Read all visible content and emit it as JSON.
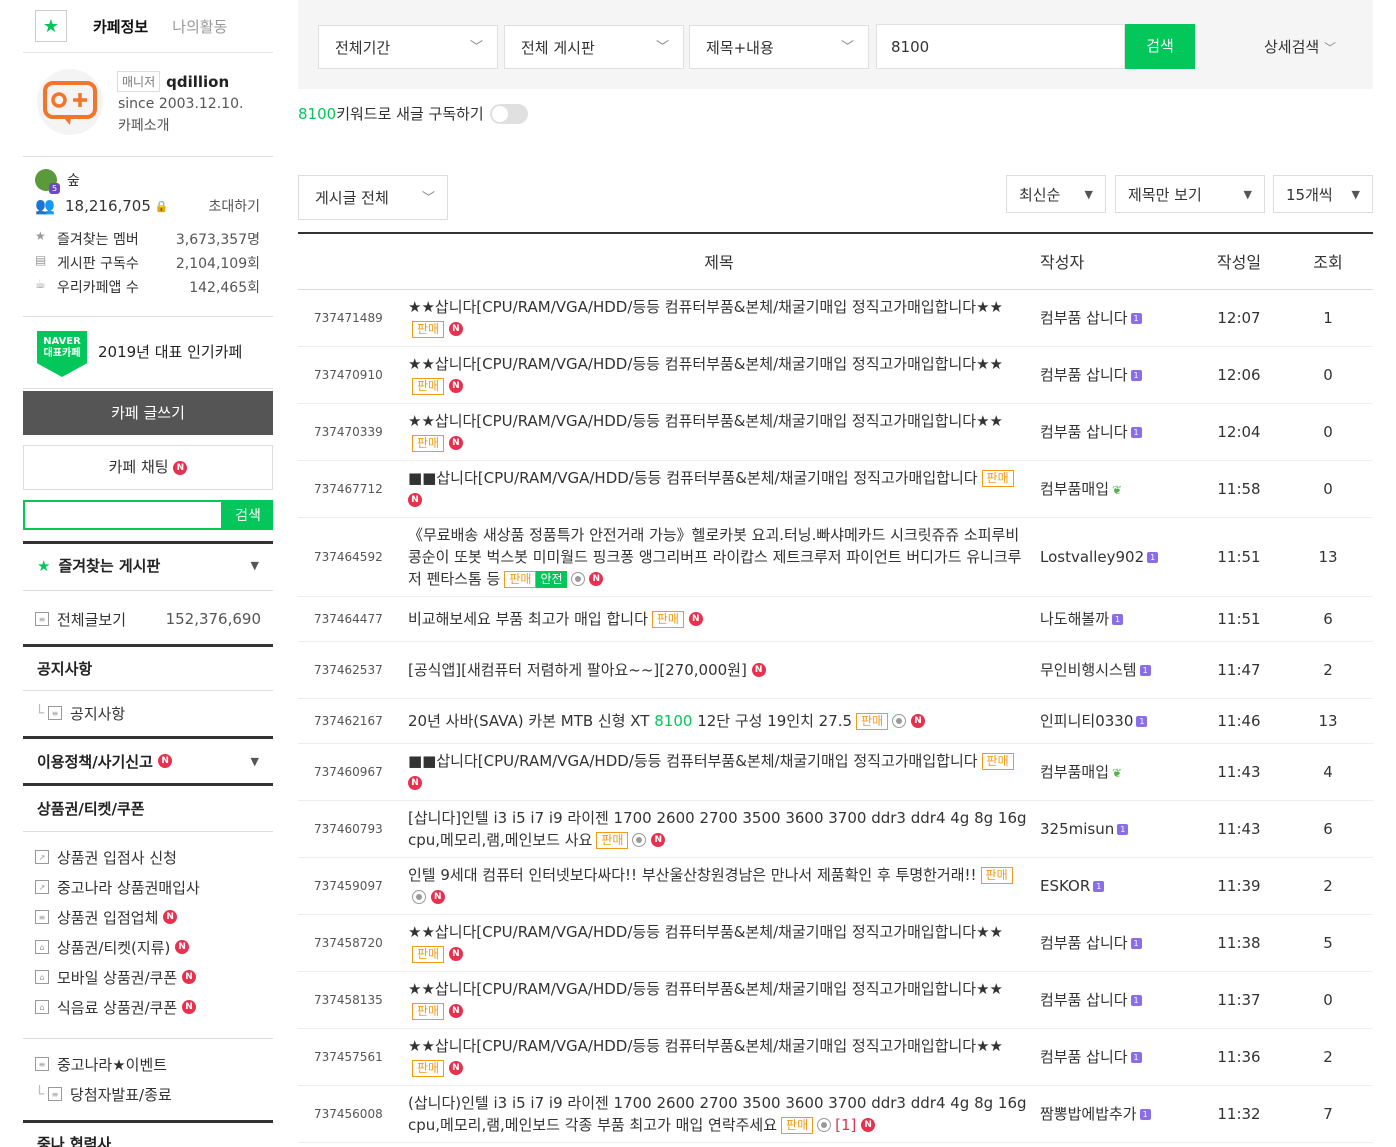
{
  "sidebar": {
    "tabs": {
      "cafe_info": "카페정보",
      "my_activity": "나의활동"
    },
    "manager_badge": "매니저",
    "manager_name": "qdillion",
    "since": "since 2003.12.10.",
    "intro": "카페소개",
    "level_name": "숲",
    "member_count": "18,216,705",
    "invite": "초대하기",
    "stats": [
      {
        "label": "즐겨찾는 멤버",
        "value": "3,673,357명",
        "icon": "star-icon"
      },
      {
        "label": "게시판 구독수",
        "value": "2,104,109회",
        "icon": "rss-icon"
      },
      {
        "label": "우리카페앱 수",
        "value": "142,465회",
        "icon": "app-icon"
      }
    ],
    "naver_badge": "NAVER 대표카페",
    "rep_text": "2019년 대표 인기카페",
    "write_button": "카페 글쓰기",
    "chat_button": "카페 채팅",
    "search_button": "검색",
    "fav_boards": "즐겨찾는 게시판",
    "all_posts": {
      "label": "전체글보기",
      "value": "152,376,690"
    },
    "notice_head": "공지사항",
    "notice_item": "공지사항",
    "policy_head": "이용정책/사기신고",
    "voucher_head": "상품권/티켓/쿠폰",
    "voucher_items": [
      {
        "label": "상품권 입점사 신청",
        "new": false
      },
      {
        "label": "중고나라 상품권매입사",
        "new": false
      },
      {
        "label": "상품권 입점업체",
        "new": true
      },
      {
        "label": "상품권/티켓(지류)",
        "new": true
      },
      {
        "label": "모바일 상품권/쿠폰",
        "new": true
      },
      {
        "label": "식음료 상품권/쿠폰",
        "new": true
      }
    ],
    "event_items": [
      {
        "label": "중고나라★이벤트"
      },
      {
        "label": "당첨자발표/종료"
      }
    ],
    "partner_head": "중나 협력사"
  },
  "search": {
    "period": "전체기간",
    "board": "전체 게시판",
    "scope": "제목+내용",
    "keyword": "8100",
    "button": "검색",
    "advanced": "상세검색",
    "subscribe_keyword": "8100",
    "subscribe_text": " 키워드로 새글 구독하기"
  },
  "filters": {
    "post_type": "게시글 전체",
    "sort": "최신순",
    "view": "제목만 보기",
    "per_page": "15개씩"
  },
  "table": {
    "headers": {
      "title": "제목",
      "author": "작성자",
      "date": "작성일",
      "views": "조회"
    },
    "rows": [
      {
        "id": "737471489",
        "title": "★★삽니다[CPU/RAM/VGA/HDD/등등 컴퓨터부품&본체/채굴기매입 정직고가매입합니다★★",
        "tags": [
          "판매"
        ],
        "photo": false,
        "new": true,
        "author": "컴부품 삽니다",
        "author_badge": "level",
        "date": "12:07",
        "views": "1"
      },
      {
        "id": "737470910",
        "title": "★★삽니다[CPU/RAM/VGA/HDD/등등 컴퓨터부품&본체/채굴기매입 정직고가매입합니다★★",
        "tags": [
          "판매"
        ],
        "photo": false,
        "new": true,
        "author": "컴부품 삽니다",
        "author_badge": "level",
        "date": "12:06",
        "views": "0"
      },
      {
        "id": "737470339",
        "title": "★★삽니다[CPU/RAM/VGA/HDD/등등 컴퓨터부품&본체/채굴기매입 정직고가매입합니다★★",
        "tags": [
          "판매"
        ],
        "photo": false,
        "new": true,
        "author": "컴부품 삽니다",
        "author_badge": "level",
        "date": "12:04",
        "views": "0"
      },
      {
        "id": "737467712",
        "title": "■■삽니다[CPU/RAM/VGA/HDD/등등 컴퓨터부품&본체/채굴기매입 정직고가매입합니다",
        "tags": [
          "판매"
        ],
        "photo": false,
        "new": true,
        "author": "컴부품매입",
        "author_badge": "sprout",
        "date": "11:58",
        "views": "0"
      },
      {
        "id": "737464592",
        "title": "《무료배송 새상품 정품특가 안전거래 가능》헬로카봇 요괴.터닝.빠샤메카드 시크릿쥬쥬 소피루비 콩순이 또봇 벅스봇 미미월드 핑크퐁 앵그리버프 라이캅스 제트크루저 파이언트 버디가드 유니크루저 펜타스톰 등",
        "tags": [
          "판매",
          "안전"
        ],
        "photo": true,
        "new": true,
        "author": "Lostvalley902",
        "author_badge": "level",
        "date": "11:51",
        "views": "13"
      },
      {
        "id": "737464477",
        "title": "비교해보세요 부품 최고가 매입 합니다",
        "tags": [
          "판매"
        ],
        "photo": false,
        "new": true,
        "author": "나도해볼까",
        "author_badge": "level",
        "date": "11:51",
        "views": "6"
      },
      {
        "id": "737462537",
        "title": "[공식앱][새컴퓨터 저렴하게 팔아요~~][270,000원]",
        "tags": [],
        "photo": false,
        "new": true,
        "author": "무인비행시스템",
        "author_badge": "level",
        "date": "11:47",
        "views": "2"
      },
      {
        "id": "737462167",
        "title_parts": [
          "20년 사바(SAVA) 카본 MTB 신형 XT ",
          "8100",
          " 12단 구성 19인치 27.5"
        ],
        "tags": [
          "판매"
        ],
        "photo": true,
        "new": true,
        "author": "인피니티0330",
        "author_badge": "level",
        "date": "11:46",
        "views": "13"
      },
      {
        "id": "737460967",
        "title": "■■삽니다[CPU/RAM/VGA/HDD/등등 컴퓨터부품&본체/채굴기매입 정직고가매입합니다",
        "tags": [
          "판매"
        ],
        "photo": false,
        "new": true,
        "author": "컴부품매입",
        "author_badge": "sprout",
        "date": "11:43",
        "views": "4"
      },
      {
        "id": "737460793",
        "title": "[삽니다]인텔 i3 i5 i7 i9 라이젠 1700 2600 2700 3500 3600 3700 ddr3 ddr4 4g 8g 16g cpu,메모리,램,메인보드 사요",
        "tags": [
          "판매"
        ],
        "photo": true,
        "new": true,
        "author": "325misun",
        "author_badge": "level",
        "date": "11:43",
        "views": "6"
      },
      {
        "id": "737459097",
        "title": "인텔 9세대 컴퓨터 인터넷보다싸다!! 부산울산창원경남은 만나서 제품확인 후 투명한거래!!",
        "tags": [
          "판매"
        ],
        "photo": true,
        "new": true,
        "author": "ESKOR",
        "author_badge": "level",
        "date": "11:39",
        "views": "2"
      },
      {
        "id": "737458720",
        "title": "★★삽니다[CPU/RAM/VGA/HDD/등등 컴퓨터부품&본체/채굴기매입 정직고가매입합니다★★",
        "tags": [
          "판매"
        ],
        "photo": false,
        "new": true,
        "author": "컴부품 삽니다",
        "author_badge": "level",
        "date": "11:38",
        "views": "5"
      },
      {
        "id": "737458135",
        "title": "★★삽니다[CPU/RAM/VGA/HDD/등등 컴퓨터부품&본체/채굴기매입 정직고가매입합니다★★",
        "tags": [
          "판매"
        ],
        "photo": false,
        "new": true,
        "author": "컴부품 삽니다",
        "author_badge": "level",
        "date": "11:37",
        "views": "0"
      },
      {
        "id": "737457561",
        "title": "★★삽니다[CPU/RAM/VGA/HDD/등등 컴퓨터부품&본체/채굴기매입 정직고가매입합니다★★",
        "tags": [
          "판매"
        ],
        "photo": false,
        "new": true,
        "author": "컴부품 삽니다",
        "author_badge": "level",
        "date": "11:36",
        "views": "2"
      },
      {
        "id": "737456008",
        "title": "(삽니다)인텔 i3 i5 i7 i9 라이젠 1700 2600 2700 3500 3600 3700 ddr3 ddr4 4g 8g 16g cpu,메모리,램,메인보드 각종 부품 최고가 매입 연락주세요",
        "tags": [
          "판매"
        ],
        "photo": true,
        "comments": "[1]",
        "new": true,
        "author": "짬뽕밥에밥추가",
        "author_badge": "level",
        "date": "11:32",
        "views": "7"
      }
    ]
  },
  "colors": {
    "accent": "#03c75a",
    "new_badge": "#e8304f",
    "tag": "#f29b1a",
    "write_button": "#555555"
  }
}
